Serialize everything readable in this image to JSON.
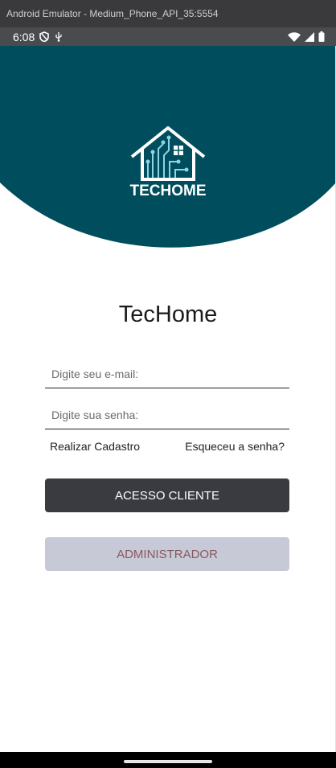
{
  "window": {
    "title": "Android Emulator - Medium_Phone_API_35:5554"
  },
  "status_bar": {
    "time": "6:08",
    "left_icons": [
      "shield-icon",
      "usb-icon"
    ],
    "right_icons": [
      "wifi-icon",
      "signal-icon",
      "battery-icon"
    ]
  },
  "header": {
    "background_color": "#004e5d",
    "logo_text": "TECHOME"
  },
  "app": {
    "title": "TecHome",
    "email_placeholder": "Digite seu e-mail:",
    "email_value": "",
    "password_placeholder": "Digite sua senha:",
    "password_value": "",
    "register_link": "Realizar Cadastro",
    "forgot_link": "Esqueceu a senha?",
    "client_button": "ACESSO CLIENTE",
    "admin_button": "ADMINISTRADOR"
  },
  "colors": {
    "client_button_bg": "#3a3a41",
    "admin_button_bg": "#c7c9d6",
    "admin_button_text": "#8a5860"
  }
}
